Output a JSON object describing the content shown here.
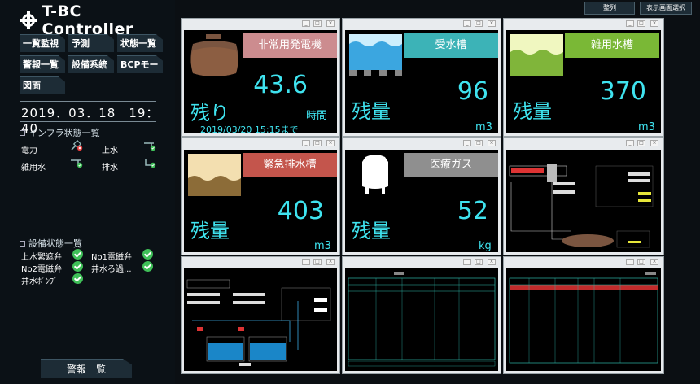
{
  "app": {
    "logo_text": "T-BC Controller"
  },
  "nav": {
    "buttons": [
      "一覧監視",
      "予測",
      "状態一覧",
      "警報一覧",
      "設備系統",
      "BCPモード",
      "図面"
    ]
  },
  "datetime": "2019．03．18　19：40",
  "infra": {
    "title": "インフラ状態一覧",
    "items": [
      {
        "label": "電力",
        "icon": "power-plug-icon",
        "status": "error"
      },
      {
        "label": "上水",
        "icon": "water-tap-icon",
        "status": "ok"
      },
      {
        "label": "雑用水",
        "icon": "water-tap-icon",
        "status": "ok"
      },
      {
        "label": "排水",
        "icon": "drain-pipe-icon",
        "status": "ok"
      }
    ]
  },
  "equipment": {
    "title": "設備状態一覧",
    "items": [
      {
        "label": "上水緊遮弁",
        "status": "ok"
      },
      {
        "label": "No1電磁弁",
        "status": "ok"
      },
      {
        "label": "No2電磁弁",
        "status": "ok"
      },
      {
        "label": "井水ろ過...",
        "status": "ok"
      },
      {
        "label": "井水ﾎﾟﾝﾌﾟ",
        "status": "ok"
      }
    ]
  },
  "alarm_button": "警報一覧",
  "top_buttons": {
    "arrange": "整列",
    "screen_select": "表示画面選択"
  },
  "tiles": {
    "generator": {
      "label": "非常用発電機",
      "remain_label": "残り",
      "value": "43.6",
      "unit": "時間",
      "until": "2019/03/20 15:15まで",
      "label_color": "#cc8c8f"
    },
    "receiving_tank": {
      "label": "受水槽",
      "remain_label": "残量",
      "value": "96",
      "unit": "m3",
      "label_color": "#3cb3b7"
    },
    "misc_water_tank": {
      "label": "雑用水槽",
      "remain_label": "残量",
      "value": "370",
      "unit": "m3",
      "label_color": "#7ab836"
    },
    "emergency_drain_tank": {
      "label": "緊急排水槽",
      "remain_label": "残量",
      "value": "403",
      "unit": "m3",
      "label_color": "#c4554c"
    },
    "medical_gas": {
      "label": "医療ガス",
      "remain_label": "残量",
      "value": "52",
      "unit": "kg",
      "label_color": "#8f8f8f"
    }
  },
  "colors": {
    "value_text": "#3fe3ef",
    "ok_green": "#3fbf58",
    "error_red": "#e23b3b"
  }
}
